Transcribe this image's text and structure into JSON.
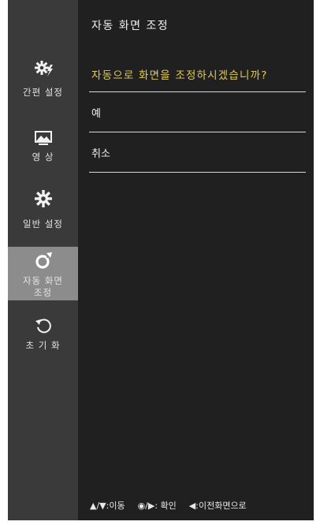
{
  "sidebar": {
    "items": [
      {
        "label": "간편 설정",
        "icon": "quick-settings-icon",
        "active": false
      },
      {
        "label": "영 상",
        "icon": "picture-icon",
        "active": false
      },
      {
        "label": "일반 설정",
        "icon": "general-settings-icon",
        "active": false
      },
      {
        "label_line1": "자동 화면",
        "label_line2": "조정",
        "icon": "auto-adjust-icon",
        "active": true
      },
      {
        "label": "초 기 화",
        "icon": "reset-icon",
        "active": false
      }
    ]
  },
  "main": {
    "title": "자동 화면 조정",
    "question": "자동으로 화면을 조정하시겠습니까?",
    "options": [
      "예",
      "취소"
    ]
  },
  "footer": {
    "move": "▲/▼:이동",
    "confirm": "◉/▶: 확인",
    "back": "◀:이전화면으로"
  },
  "colors": {
    "background": "#202020",
    "sidebar": "#3a3a3a",
    "active_item": "#8c8c8c",
    "accent": "#e0c85a"
  }
}
